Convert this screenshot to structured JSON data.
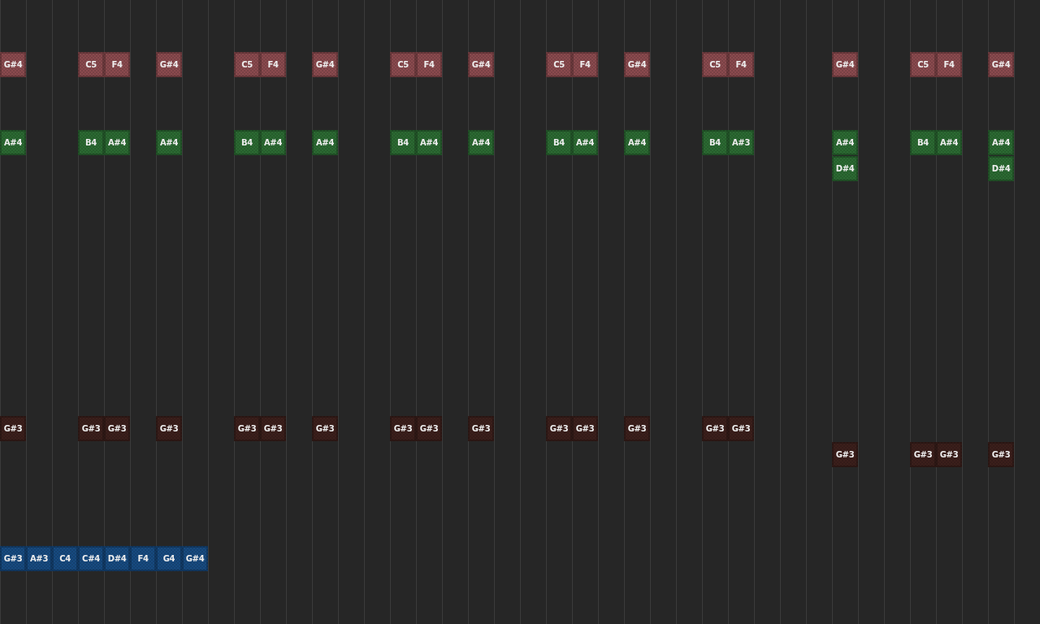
{
  "notes": [
    {
      "label": "G#4",
      "color": "#8a4a4e"
    },
    {
      "label": "C5",
      "color": "#8a4a4e"
    },
    {
      "label": "F4",
      "color": "#8a4a4e"
    },
    {
      "label": "G#4",
      "color": "#8a4a4e"
    },
    {
      "label": "C5",
      "color": "#8a4a4e"
    },
    {
      "label": "F4",
      "color": "#8a4a4e"
    },
    {
      "label": "G#4",
      "color": "#8a4a4e"
    },
    {
      "label": "C5",
      "color": "#8a4a4e"
    },
    {
      "label": "F4",
      "color": "#8a4a4e"
    },
    {
      "label": "G#4",
      "color": "#8a4a4e"
    },
    {
      "label": "C5",
      "color": "#8a4a4e"
    },
    {
      "label": "F4",
      "color": "#8a4a4e"
    },
    {
      "label": "G#4",
      "color": "#8a4a4e"
    },
    {
      "label": "C5",
      "color": "#8a4a4e"
    },
    {
      "label": "F4",
      "color": "#8a4a4e"
    },
    {
      "label": "G#4",
      "color": "#8a4a4e"
    },
    {
      "label": "C5",
      "color": "#8a4a4e"
    },
    {
      "label": "F4",
      "color": "#8a4a4e"
    },
    {
      "label": "G#4",
      "color": "#8a4a4e"
    },
    {
      "label": "A#4",
      "color": "#2b6a32"
    },
    {
      "label": "B4",
      "color": "#2b6a32"
    },
    {
      "label": "A#4",
      "color": "#2b6a32"
    },
    {
      "label": "A#4",
      "color": "#2b6a32"
    },
    {
      "label": "B4",
      "color": "#2b6a32"
    },
    {
      "label": "A#4",
      "color": "#2b6a32"
    },
    {
      "label": "A#4",
      "color": "#2b6a32"
    },
    {
      "label": "B4",
      "color": "#2b6a32"
    },
    {
      "label": "A#4",
      "color": "#2b6a32"
    },
    {
      "label": "A#4",
      "color": "#2b6a32"
    },
    {
      "label": "B4",
      "color": "#2b6a32"
    },
    {
      "label": "A#4",
      "color": "#2b6a32"
    },
    {
      "label": "A#4",
      "color": "#2b6a32"
    },
    {
      "label": "B4",
      "color": "#2b6a32"
    },
    {
      "label": "A#3",
      "color": "#2b6a32"
    },
    {
      "label": "A#4",
      "color": "#2b6a32"
    },
    {
      "label": "B4",
      "color": "#2b6a32"
    },
    {
      "label": "A#4",
      "color": "#2b6a32"
    },
    {
      "label": "A#4",
      "color": "#2b6a32"
    },
    {
      "label": "D#4",
      "color": "#2b6a32"
    },
    {
      "label": "D#4",
      "color": "#2b6a32"
    },
    {
      "label": "G#3",
      "color": "#3b1f1b"
    },
    {
      "label": "G#3",
      "color": "#3b1f1b"
    },
    {
      "label": "G#3",
      "color": "#3b1f1b"
    },
    {
      "label": "G#3",
      "color": "#3b1f1b"
    },
    {
      "label": "G#3",
      "color": "#3b1f1b"
    },
    {
      "label": "G#3",
      "color": "#3b1f1b"
    },
    {
      "label": "G#3",
      "color": "#3b1f1b"
    },
    {
      "label": "G#3",
      "color": "#3b1f1b"
    },
    {
      "label": "G#3",
      "color": "#3b1f1b"
    },
    {
      "label": "G#3",
      "color": "#3b1f1b"
    },
    {
      "label": "G#3",
      "color": "#3b1f1b"
    },
    {
      "label": "G#3",
      "color": "#3b1f1b"
    },
    {
      "label": "G#3",
      "color": "#3b1f1b"
    },
    {
      "label": "G#3",
      "color": "#3b1f1b"
    },
    {
      "label": "G#3",
      "color": "#3b1f1b"
    },
    {
      "label": "G#3",
      "color": "#3b1f1b"
    },
    {
      "label": "G#3",
      "color": "#3b1f1b"
    },
    {
      "label": "G#3",
      "color": "#3b1f1b"
    },
    {
      "label": "G#3",
      "color": "#3b1f1b"
    },
    {
      "label": "G#3",
      "color": "#174a80"
    },
    {
      "label": "A#3",
      "color": "#174a80"
    },
    {
      "label": "C4",
      "color": "#174a80"
    },
    {
      "label": "C#4",
      "color": "#174a80"
    },
    {
      "label": "D#4",
      "color": "#174a80"
    },
    {
      "label": "F4",
      "color": "#174a80"
    },
    {
      "label": "G4",
      "color": "#174a80"
    },
    {
      "label": "G#4",
      "color": "#174a80"
    }
  ]
}
